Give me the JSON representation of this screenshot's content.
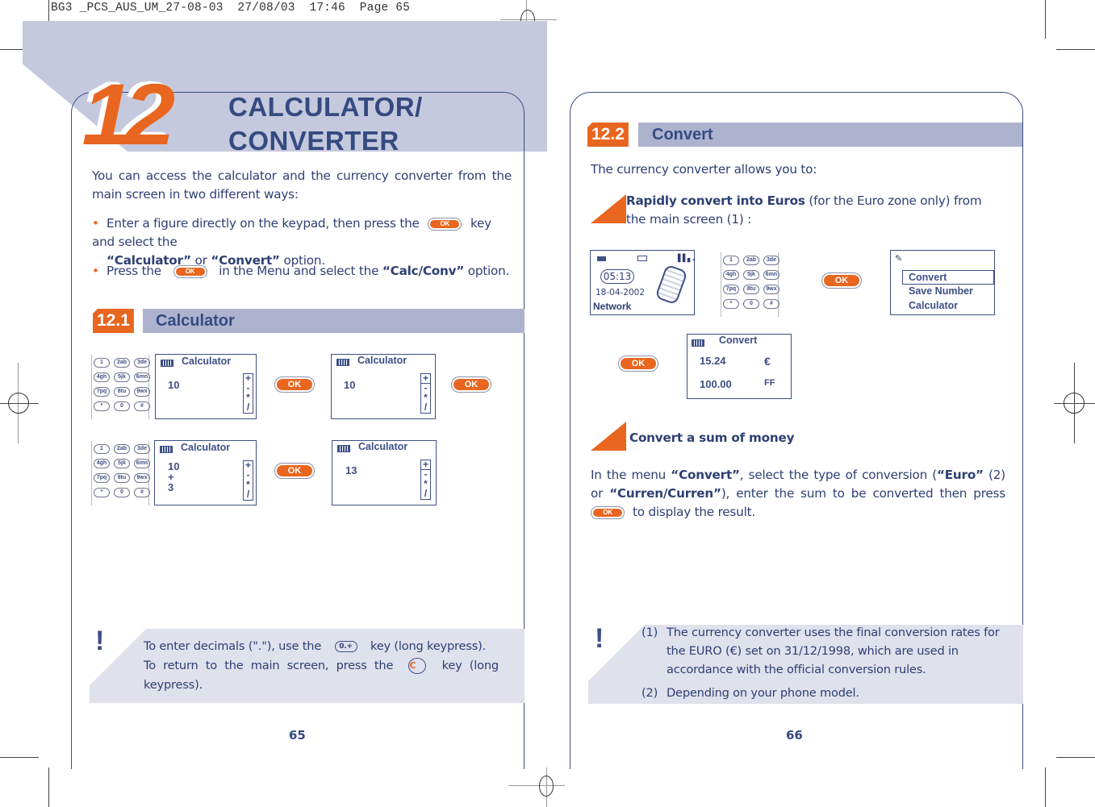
{
  "slug": "BG3 _PCS_AUS_UM_27-08-03  27/08/03  17:46  Page 65",
  "chapter": {
    "number": "12",
    "title_line1": "CALCULATOR/",
    "title_line2": "CONVERTER"
  },
  "intro": {
    "paragraph": "You can access the calculator and the currency converter from the main screen in two different ways:",
    "bullet1_a": "Enter a figure directly on the keypad, then press the",
    "bullet1_b": "key and select the",
    "bullet1_calc": "“Calculator”",
    "bullet1_or": "or",
    "bullet1_conv": "“Convert”",
    "bullet1_c": "option.",
    "bullet2_a": "Press the",
    "bullet2_b": "in the Menu and select the",
    "bullet2_bold": "“Calc/Conv”",
    "bullet2_c": "option."
  },
  "ok_label": "OK",
  "section_calculator": {
    "number": "12.1",
    "title": "Calculator",
    "screens": [
      {
        "title": "Calculator",
        "lines": [
          "10"
        ],
        "operators": [
          "+",
          "-",
          "*",
          "/"
        ],
        "selected_operator": ""
      },
      {
        "title": "Calculator",
        "lines": [
          "10"
        ],
        "operators": [
          "+",
          "-",
          "*",
          "/"
        ],
        "selected_operator": "+"
      },
      {
        "title": "Calculator",
        "lines": [
          "10",
          "+",
          "3"
        ],
        "operators": [
          "+",
          "-",
          "*",
          "/"
        ],
        "selected_operator": ""
      },
      {
        "title": "Calculator",
        "lines": [
          "13"
        ],
        "operators": [
          "+",
          "-",
          "*",
          "/"
        ],
        "selected_operator": "+"
      }
    ]
  },
  "keypad": {
    "keys": [
      "1",
      "2abc",
      "3def",
      "4ghi",
      "5jkl",
      "6mno",
      "7pqrs",
      "8tuv",
      "9wxyz",
      "*",
      "0 +",
      "#"
    ]
  },
  "note_left": {
    "line1_a": "To enter decimals (\".\"), use the",
    "line1_key": "0.+",
    "line1_b": "key (long keypress).",
    "line2_a": "To return to the main screen, press the",
    "line2_key": "C",
    "line2_b": "key (long keypress)."
  },
  "page_left_number": "65",
  "section_convert": {
    "number": "12.2",
    "title": "Convert",
    "intro": "The currency converter allows you to:",
    "item1_bold": "Rapidly convert into Euros",
    "item1_rest": "(for the Euro zone only) from the main screen (1) :",
    "home_screen": {
      "time": "05:13",
      "date": "18-04-2002",
      "network": "Network"
    },
    "menu_screen": {
      "items": [
        "Convert",
        "Save Number",
        "Calculator"
      ],
      "selected": "Convert"
    },
    "convert_screen": {
      "title": "Convert",
      "row1_value": "15.24",
      "row1_unit": "€",
      "row2_value": "100.00",
      "row2_unit": "FF"
    },
    "item2_bold": "Convert a sum of money",
    "para_a": "In the menu",
    "para_convert": "“Convert”",
    "para_b": ", select the type of conversion (",
    "para_euro": "“Euro”",
    "para_c": "(2) or",
    "para_curren": "“Curren/Curren”",
    "para_d": "), enter the sum to be converted then press",
    "para_e": "to display the result."
  },
  "note_right": {
    "n1_label": "(1)",
    "n1_text": "The currency converter uses the final conversion rates for the EURO (€) set on 31/12/1998, which are used in accordance with the official conversion rules.",
    "n2_label": "(2)",
    "n2_text": "Depending on your phone model."
  },
  "page_right_number": "66"
}
